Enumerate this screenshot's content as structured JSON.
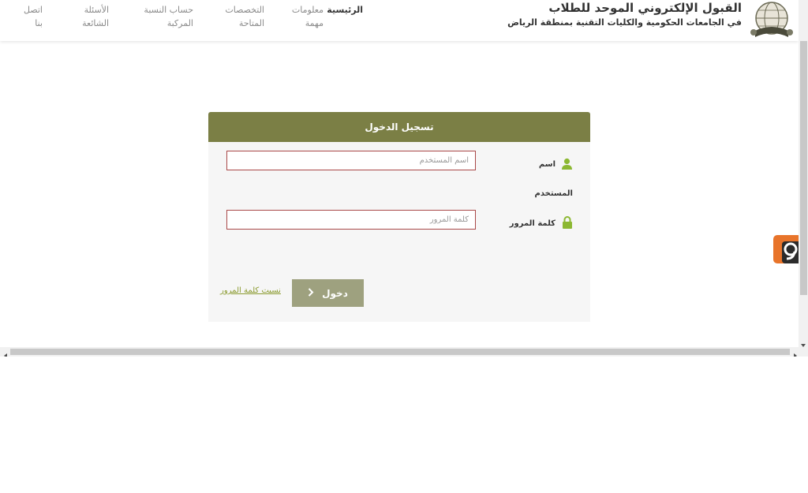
{
  "header": {
    "title": "القبول الإلكتروني الموحد للطلاب",
    "subtitle": "في الجامعات الحكومية والكليات التقنية بمنطقة الرياض",
    "nav": [
      {
        "label": "الرئيسية",
        "active": true
      },
      {
        "label": "معلومات\nمهمة",
        "active": false
      },
      {
        "label": "التخصصات\nالمتاحة",
        "active": false
      },
      {
        "label": "حساب النسبة\nالمركبة",
        "active": false
      },
      {
        "label": "الأسئلة\nالشائعة",
        "active": false
      },
      {
        "label": "اتصل\nبنا",
        "active": false
      }
    ]
  },
  "login": {
    "heading": "تسجيل الدخول",
    "username_label_line1": "اسم",
    "username_label_line2": "المستخدم",
    "username_placeholder": "اسم المستخدم",
    "username_value": "",
    "password_label": "كلمة المرور",
    "password_placeholder": "كلمة المرور",
    "password_value": "",
    "submit_label": "دخول",
    "forgot_label": "نسيت كلمة المرور"
  },
  "colors": {
    "header_bar": "#7b7f45",
    "icon_green": "#8cb832",
    "input_border": "#a94848",
    "button": "#9ea17f",
    "link": "#8a9a2e"
  },
  "icons": {
    "logo": "globe-book-emblem",
    "username": "user-icon",
    "password": "lock-icon",
    "submit": "chevron-right-icon",
    "widget": "camera-widget-icon"
  }
}
